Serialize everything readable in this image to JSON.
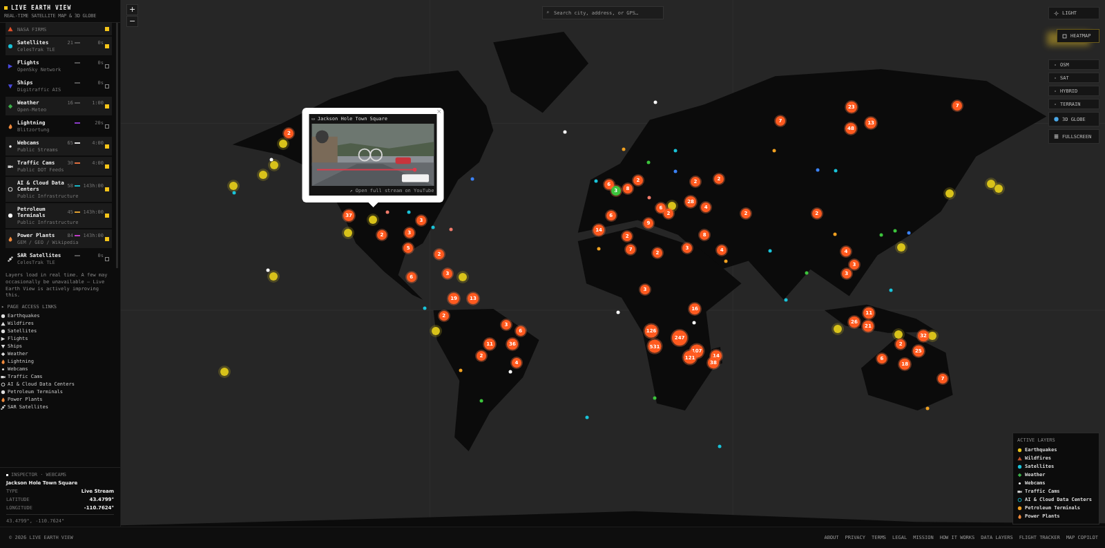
{
  "app": {
    "title": "LIVE EARTH VIEW",
    "subtitle": "REAL-TIME SATELLITE MAP & 3D GLOBE"
  },
  "layers": [
    {
      "source": "NASA FIRMS",
      "kind": "wildfire",
      "checked": true
    },
    {
      "name": "Satellites",
      "source": "CelesTrak TLE",
      "count": "21",
      "time": "0s",
      "kind": "satellite",
      "color": "#555555",
      "checked": true
    },
    {
      "name": "Flights",
      "source": "OpenSky Network",
      "time": "0s",
      "kind": "flight",
      "color": "#555555",
      "checked": false
    },
    {
      "name": "Ships",
      "source": "Digitraffic AIS",
      "time": "0s",
      "kind": "ship",
      "color": "#555555",
      "checked": false
    },
    {
      "name": "Weather",
      "source": "Open-Meteo",
      "count": "16",
      "time": "1:00",
      "kind": "weather",
      "color": "#555555",
      "checked": true
    },
    {
      "name": "Lightning",
      "source": "Blitzortung",
      "time": "20s",
      "kind": "lightning",
      "color": "#8a3cc8",
      "checked": false
    },
    {
      "name": "Webcams",
      "source": "Public Streams",
      "count": "65",
      "time": "4:00",
      "kind": "webcam",
      "color": "#dddddd",
      "checked": true
    },
    {
      "name": "Traffic Cams",
      "source": "Public DOT Feeds",
      "count": "30",
      "time": "4:00",
      "kind": "traffic",
      "color": "#e07040",
      "checked": true
    },
    {
      "name": "AI & Cloud Data Centers",
      "source": "Public Infrastructure",
      "count": "58",
      "time": "143h:00",
      "kind": "datacenter",
      "color": "#19b8c8",
      "checked": true
    },
    {
      "name": "Petroleum Terminals",
      "source": "Public Infrastructure",
      "count": "45",
      "time": "143h:00",
      "kind": "petroleum",
      "color": "#e0a030",
      "checked": true
    },
    {
      "name": "Power Plants",
      "source": "GEM / GEO / Wikipedia",
      "count": "84",
      "time": "143h:00",
      "kind": "power",
      "color": "#c03cc8",
      "checked": true
    },
    {
      "name": "SAR Satellites",
      "source": "CelesTrak TLE",
      "time": "0s",
      "kind": "sar",
      "color": "#555555",
      "checked": false
    }
  ],
  "layers_note": "Layers load in real time. A few may occasionally be unavailable — Live Earth View is actively improving this.",
  "page_links": {
    "heading": "▸ PAGE ACCESS LINKS",
    "items": [
      {
        "label": "Earthquakes",
        "kind": "earthquake"
      },
      {
        "label": "Wildfires",
        "kind": "wildfire"
      },
      {
        "label": "Satellites",
        "kind": "satellite"
      },
      {
        "label": "Flights",
        "kind": "flight"
      },
      {
        "label": "Ships",
        "kind": "ship"
      },
      {
        "label": "Weather",
        "kind": "weather"
      },
      {
        "label": "Lightning",
        "kind": "lightning"
      },
      {
        "label": "Webcams",
        "kind": "webcam"
      },
      {
        "label": "Traffic Cams",
        "kind": "traffic"
      },
      {
        "label": "AI & Cloud Data Centers",
        "kind": "datacenter"
      },
      {
        "label": "Petroleum Terminals",
        "kind": "petroleum"
      },
      {
        "label": "Power Plants",
        "kind": "power"
      },
      {
        "label": "SAR Satellites",
        "kind": "sar"
      }
    ]
  },
  "inspector": {
    "heading": "INSPECTOR · WEBCAMS",
    "title": "Jackson Hole Town Square",
    "fields": [
      {
        "label": "TYPE",
        "value": "Live Stream"
      },
      {
        "label": "LATITUDE",
        "value": "43.4799°"
      },
      {
        "label": "LONGITUDE",
        "value": "-110.7624°"
      }
    ],
    "coords": "43.4799°, -110.7624°"
  },
  "copyright": "© 2026 LIVE EARTH VIEW",
  "footer_links": [
    "ABOUT",
    "PRIVACY",
    "TERMS",
    "LEGAL",
    "MISSION",
    "HOW IT WORKS",
    "DATA LAYERS",
    "FLIGHT TRACKER",
    "MAP COPILOT"
  ],
  "zoom": {
    "in": "+",
    "out": "−"
  },
  "search": {
    "icon": "⌕",
    "placeholder": "Search city, address, or GPS…"
  },
  "controls": [
    {
      "label": "LIGHT",
      "kind": "light",
      "selected": false
    },
    {
      "label": "HEATMAP",
      "kind": "heatmap",
      "selected": true
    },
    {
      "label": "OSM",
      "kind": "base",
      "selected": false
    },
    {
      "label": "SAT",
      "kind": "base",
      "selected": false
    },
    {
      "label": "HYBRID",
      "kind": "base",
      "selected": false
    },
    {
      "label": "TERRAIN",
      "kind": "base",
      "selected": false
    },
    {
      "label": "3D GLOBE",
      "kind": "globe",
      "selected": false
    },
    {
      "label": "FULLSCREEN",
      "kind": "fullscreen",
      "selected": false
    }
  ],
  "popup": {
    "icon": "▭",
    "title": "Jackson Hole Town Square",
    "link": "↗ Open full stream on YouTube",
    "close": "×"
  },
  "legend": {
    "heading": "ACTIVE LAYERS",
    "items": [
      {
        "label": "Earthquakes",
        "kind": "earthquake",
        "color": "#e6c21a"
      },
      {
        "label": "Wildfires",
        "kind": "wildfire",
        "color": "#c0502a"
      },
      {
        "label": "Satellites",
        "kind": "satellite",
        "color": "#19c3d9"
      },
      {
        "label": "Weather",
        "kind": "weather",
        "color": "#3cb04a"
      },
      {
        "label": "Webcams",
        "kind": "webcam",
        "color": "#ffffff"
      },
      {
        "label": "Traffic Cams",
        "kind": "traffic",
        "color": "#cccccc"
      },
      {
        "label": "AI & Cloud Data Centers",
        "kind": "datacenter",
        "color": "#19b8c8"
      },
      {
        "label": "Petroleum Terminals",
        "kind": "petroleum",
        "color": "#f0a020"
      },
      {
        "label": "Power Plants",
        "kind": "power",
        "color": "#f08a3c"
      }
    ]
  },
  "markers": [
    {
      "kind": "quake",
      "color": "#d8c21a"
    },
    {
      "kind": "quake",
      "color": "#d8c21a"
    },
    {
      "kind": "quake",
      "color": "#d8c21a"
    },
    {
      "kind": "quake",
      "color": "#d8c21a"
    },
    {
      "kind": "quake",
      "color": "#d8c21a"
    },
    {
      "kind": "quake",
      "color": "#d8c21a"
    },
    {
      "kind": "quake",
      "color": "#d8c21a"
    },
    {
      "kind": "quake",
      "color": "#d8c21a"
    },
    {
      "kind": "quake",
      "color": "#d8c21a"
    },
    {
      "kind": "quake",
      "color": "#d8c21a"
    },
    {
      "kind": "quake",
      "color": "#d8c21a"
    },
    {
      "kind": "quake",
      "color": "#d8c21a"
    },
    {
      "kind": "quake",
      "color": "#d8c21a"
    },
    {
      "kind": "quake",
      "color": "#d8c21a"
    },
    {
      "kind": "quake",
      "color": "#d8c21a"
    },
    {
      "kind": "quake",
      "color": "#d8c21a"
    },
    {
      "kind": "quake",
      "color": "#d8c21a"
    },
    {
      "kind": "quake",
      "color": "#d8c21a"
    },
    {
      "kind": "dot",
      "color": "#ffffff"
    },
    {
      "kind": "dot",
      "color": "#19c3d9"
    },
    {
      "kind": "dot",
      "color": "#ffffff"
    },
    {
      "kind": "dot",
      "color": "#ffffff"
    },
    {
      "kind": "dot",
      "color": "#ffffff"
    },
    {
      "kind": "dot",
      "color": "#f0a020"
    },
    {
      "kind": "dot",
      "color": "#19c3d9"
    },
    {
      "kind": "dot",
      "color": "#3cc43c"
    },
    {
      "kind": "dot",
      "color": "#3b82f6"
    },
    {
      "kind": "dot",
      "color": "#19c3d9"
    },
    {
      "kind": "dot",
      "color": "#f07a6a"
    },
    {
      "kind": "dot",
      "color": "#3b82f6"
    },
    {
      "kind": "dot",
      "color": "#19c3d9"
    },
    {
      "kind": "dot",
      "color": "#f0a020"
    },
    {
      "kind": "dot",
      "color": "#f0a020"
    },
    {
      "kind": "dot",
      "color": "#19c3d9"
    },
    {
      "kind": "dot",
      "color": "#19c3d9"
    },
    {
      "kind": "dot",
      "color": "#3cc43c"
    },
    {
      "kind": "dot",
      "color": "#3cc43c"
    },
    {
      "kind": "dot",
      "color": "#3cc43c"
    },
    {
      "kind": "dot",
      "color": "#3b82f6"
    },
    {
      "kind": "dot",
      "color": "#19c3d9"
    },
    {
      "kind": "dot",
      "color": "#3b82f6"
    },
    {
      "kind": "dot",
      "color": "#19c3d9"
    },
    {
      "kind": "dot",
      "color": "#19c3d9"
    },
    {
      "kind": "dot",
      "color": "#f07a6a"
    },
    {
      "kind": "dot",
      "color": "#f07a6a"
    },
    {
      "kind": "dot",
      "color": "#19c3d9"
    },
    {
      "kind": "dot",
      "color": "#ffffff"
    },
    {
      "kind": "dot",
      "color": "#ffffff"
    },
    {
      "kind": "dot",
      "color": "#3cc43c"
    },
    {
      "kind": "dot",
      "color": "#19c3d9"
    },
    {
      "kind": "dot",
      "color": "#19c3d9"
    },
    {
      "kind": "dot",
      "color": "#f0a020"
    },
    {
      "kind": "dot",
      "color": "#3cc43c"
    },
    {
      "kind": "dot",
      "color": "#ffffff"
    },
    {
      "kind": "dot",
      "color": "#f0a020"
    },
    {
      "kind": "dot",
      "color": "#f0a020"
    },
    {
      "kind": "dot",
      "color": "#f0a020"
    },
    {
      "kind": "cluster",
      "count": "2",
      "color": "#ff5a1f"
    },
    {
      "kind": "cluster",
      "count": "37",
      "color": "#ff5a1f"
    },
    {
      "kind": "cluster",
      "count": "2",
      "color": "#ff5a1f"
    },
    {
      "kind": "cluster",
      "count": "3",
      "color": "#ff5a1f"
    },
    {
      "kind": "cluster",
      "count": "3",
      "color": "#ff5a1f"
    },
    {
      "kind": "cluster",
      "count": "5",
      "color": "#ff5a1f"
    },
    {
      "kind": "cluster",
      "count": "2",
      "color": "#ff5a1f"
    },
    {
      "kind": "cluster",
      "count": "3",
      "color": "#ff5a1f"
    },
    {
      "kind": "cluster",
      "count": "6",
      "color": "#ff5a1f"
    },
    {
      "kind": "cluster",
      "count": "19",
      "color": "#ff5a1f"
    },
    {
      "kind": "cluster",
      "count": "13",
      "color": "#ff5a1f"
    },
    {
      "kind": "cluster",
      "count": "2",
      "color": "#ff5a1f"
    },
    {
      "kind": "cluster",
      "count": "3",
      "color": "#ff5a1f"
    },
    {
      "kind": "cluster",
      "count": "6",
      "color": "#ff5a1f"
    },
    {
      "kind": "cluster",
      "count": "11",
      "color": "#ff5a1f"
    },
    {
      "kind": "cluster",
      "count": "36",
      "color": "#ff5a1f"
    },
    {
      "kind": "cluster",
      "count": "2",
      "color": "#ff5a1f"
    },
    {
      "kind": "cluster",
      "count": "4",
      "color": "#ff5a1f"
    },
    {
      "kind": "cluster",
      "count": "6",
      "color": "#ff5a1f"
    },
    {
      "kind": "cluster",
      "count": "3",
      "color": "#3cc43c"
    },
    {
      "kind": "cluster",
      "count": "8",
      "color": "#ff5a1f"
    },
    {
      "kind": "cluster",
      "count": "2",
      "color": "#ff5a1f"
    },
    {
      "kind": "cluster",
      "count": "6",
      "color": "#ff5a1f"
    },
    {
      "kind": "cluster",
      "count": "2",
      "color": "#ff5a1f"
    },
    {
      "kind": "cluster",
      "count": "28",
      "color": "#ff5a1f"
    },
    {
      "kind": "cluster",
      "count": "2",
      "color": "#ff5a1f"
    },
    {
      "kind": "cluster",
      "count": "2",
      "color": "#ff5a1f"
    },
    {
      "kind": "cluster",
      "count": "4",
      "color": "#ff5a1f"
    },
    {
      "kind": "cluster",
      "count": "2",
      "color": "#ff5a1f"
    },
    {
      "kind": "cluster",
      "count": "2",
      "color": "#ff5a1f"
    },
    {
      "kind": "cluster",
      "count": "6",
      "color": "#ff5a1f"
    },
    {
      "kind": "cluster",
      "count": "9",
      "color": "#ff5a1f"
    },
    {
      "kind": "cluster",
      "count": "2",
      "color": "#ff5a1f"
    },
    {
      "kind": "cluster",
      "count": "14",
      "color": "#ff5a1f"
    },
    {
      "kind": "cluster",
      "count": "7",
      "color": "#ff5a1f"
    },
    {
      "kind": "cluster",
      "count": "2",
      "color": "#ff5a1f"
    },
    {
      "kind": "cluster",
      "count": "3",
      "color": "#ff5a1f"
    },
    {
      "kind": "cluster",
      "count": "8",
      "color": "#ff5a1f"
    },
    {
      "kind": "cluster",
      "count": "4",
      "color": "#ff5a1f"
    },
    {
      "kind": "cluster",
      "count": "3",
      "color": "#ff5a1f"
    },
    {
      "kind": "cluster",
      "count": "16",
      "color": "#ff5a1f"
    },
    {
      "kind": "cluster",
      "count": "126",
      "color": "#ff5a1f"
    },
    {
      "kind": "cluster",
      "count": "531",
      "color": "#ff5a1f"
    },
    {
      "kind": "cluster",
      "count": "247",
      "color": "#ff5a1f"
    },
    {
      "kind": "cluster",
      "count": "107",
      "color": "#ff5a1f"
    },
    {
      "kind": "cluster",
      "count": "121",
      "color": "#ff5a1f"
    },
    {
      "kind": "cluster",
      "count": "14",
      "color": "#ff5a1f"
    },
    {
      "kind": "cluster",
      "count": "38",
      "color": "#ff5a1f"
    },
    {
      "kind": "cluster",
      "count": "23",
      "color": "#ff5a1f"
    },
    {
      "kind": "cluster",
      "count": "7",
      "color": "#ff5a1f"
    },
    {
      "kind": "cluster",
      "count": "48",
      "color": "#ff5a1f"
    },
    {
      "kind": "cluster",
      "count": "13",
      "color": "#ff5a1f"
    },
    {
      "kind": "cluster",
      "count": "7",
      "color": "#ff5a1f"
    },
    {
      "kind": "cluster",
      "count": "4",
      "color": "#ff5a1f"
    },
    {
      "kind": "cluster",
      "count": "3",
      "color": "#ff5a1f"
    },
    {
      "kind": "cluster",
      "count": "3",
      "color": "#ff5a1f"
    },
    {
      "kind": "cluster",
      "count": "11",
      "color": "#ff5a1f"
    },
    {
      "kind": "cluster",
      "count": "26",
      "color": "#ff5a1f"
    },
    {
      "kind": "cluster",
      "count": "21",
      "color": "#ff5a1f"
    },
    {
      "kind": "cluster",
      "count": "32",
      "color": "#ff5a1f"
    },
    {
      "kind": "cluster",
      "count": "2",
      "color": "#ff5a1f"
    },
    {
      "kind": "cluster",
      "count": "25",
      "color": "#ff5a1f"
    },
    {
      "kind": "cluster",
      "count": "6",
      "color": "#ff5a1f"
    },
    {
      "kind": "cluster",
      "count": "18",
      "color": "#ff5a1f"
    },
    {
      "kind": "cluster",
      "count": "7",
      "color": "#ff5a1f"
    }
  ]
}
